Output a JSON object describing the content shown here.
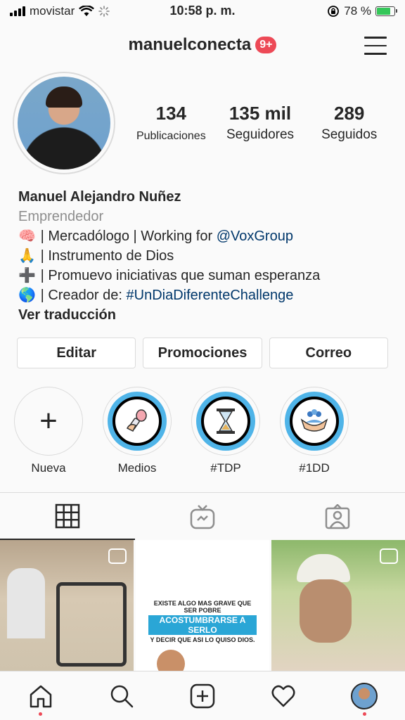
{
  "status_bar": {
    "carrier": "movistar",
    "time": "10:58 p. m.",
    "battery": "78 %",
    "battery_level": 0.78
  },
  "header": {
    "username": "manuelconecta",
    "notification_badge": "9+"
  },
  "profile": {
    "stats": [
      {
        "value": "134",
        "label": "Publicaciones"
      },
      {
        "value": "135 mil",
        "label": "Seguidores"
      },
      {
        "value": "289",
        "label": "Seguidos"
      }
    ],
    "name": "Manuel Alejandro Nuñez",
    "category": "Emprendedor",
    "bio": {
      "line1_emoji": "🧠",
      "line1_text": "| Mercadólogo | Working for ",
      "line1_link": "@VoxGroup",
      "line2_emoji": "🙏",
      "line2_text": "| Instrumento de Dios",
      "line3_emoji": "➕",
      "line3_text": "| Promuevo iniciativas que suman esperanza",
      "line4_emoji": "🌎",
      "line4_text": "| Creador de: ",
      "line4_link": "#UnDiaDiferenteChallenge"
    },
    "see_translation": "Ver traducción"
  },
  "buttons": {
    "edit": "Editar",
    "promotions": "Promociones",
    "email": "Correo"
  },
  "highlights": [
    {
      "label": "Nueva",
      "icon": "plus-icon"
    },
    {
      "label": "Medios",
      "icon": "microphone-icon"
    },
    {
      "label": "#TDP",
      "icon": "hourglass-icon"
    },
    {
      "label": "#1DD",
      "icon": "hands-people-icon"
    }
  ],
  "posts": {
    "post2_line1": "EXISTE ALGO MAS GRAVE QUE SER POBRE",
    "post2_line2": "ACOSTUMBRARSE A SERLO",
    "post2_line3": "Y DECIR QUE ASI LO QUISO DIOS."
  },
  "colors": {
    "accent_blue": "#4fb4e8",
    "badge_red": "#ed4956",
    "link": "#00376b"
  }
}
